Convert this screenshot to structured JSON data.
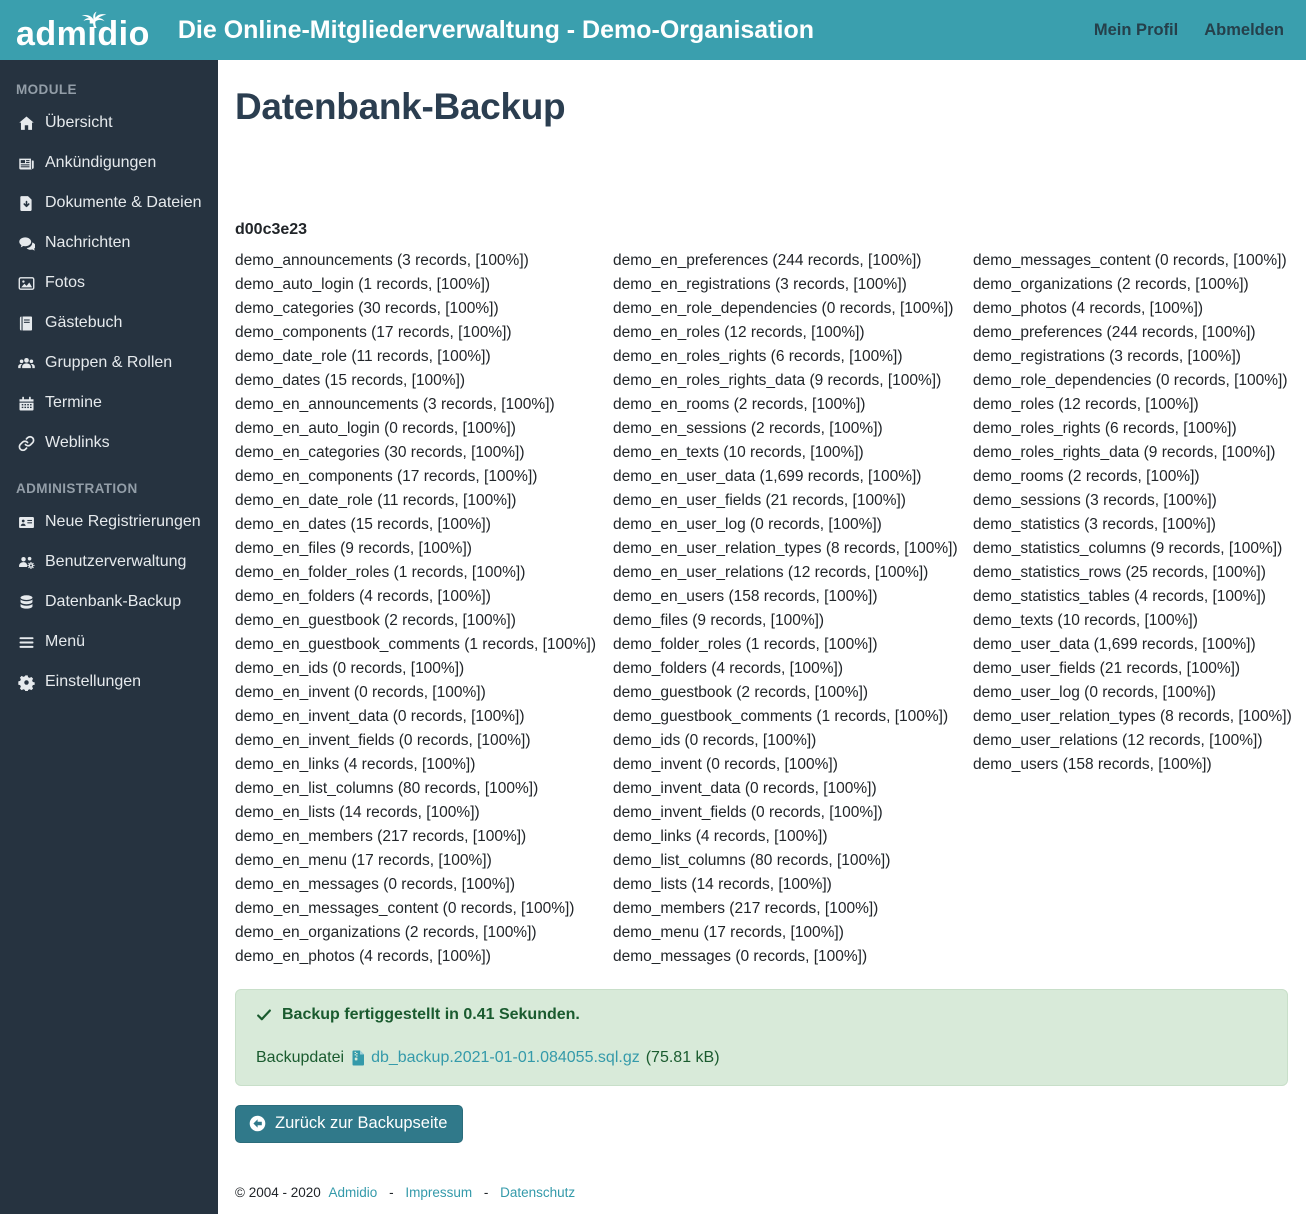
{
  "header": {
    "logo": "admidio",
    "title": "Die Online-Mitgliederverwaltung - Demo-Organisation",
    "nav": [
      {
        "label": "Mein Profil"
      },
      {
        "label": "Abmelden"
      }
    ]
  },
  "sidebar": {
    "sections": [
      {
        "label": "MODULE",
        "items": [
          {
            "icon": "home-icon",
            "label": "Übersicht"
          },
          {
            "icon": "newspaper-icon",
            "label": "Ankündigungen"
          },
          {
            "icon": "file-download-icon",
            "label": "Dokumente & Dateien"
          },
          {
            "icon": "comments-icon",
            "label": "Nachrichten"
          },
          {
            "icon": "image-icon",
            "label": "Fotos"
          },
          {
            "icon": "book-icon",
            "label": "Gästebuch"
          },
          {
            "icon": "users-icon",
            "label": "Gruppen & Rollen"
          },
          {
            "icon": "calendar-icon",
            "label": "Termine"
          },
          {
            "icon": "link-icon",
            "label": "Weblinks"
          }
        ]
      },
      {
        "label": "ADMINISTRATION",
        "items": [
          {
            "icon": "address-card-icon",
            "label": "Neue Registrierungen"
          },
          {
            "icon": "users-cog-icon",
            "label": "Benutzerverwaltung"
          },
          {
            "icon": "database-icon",
            "label": "Datenbank-Backup"
          },
          {
            "icon": "bars-icon",
            "label": "Menü"
          },
          {
            "icon": "gear-icon",
            "label": "Einstellungen"
          }
        ]
      }
    ]
  },
  "main": {
    "page_title": "Datenbank-Backup",
    "db_name": "d00c3e23",
    "tables": [
      "demo_announcements (3 records, [100%])",
      "demo_auto_login (1 records, [100%])",
      "demo_categories (30 records, [100%])",
      "demo_components (17 records, [100%])",
      "demo_date_role (11 records, [100%])",
      "demo_dates (15 records, [100%])",
      "demo_en_announcements (3 records, [100%])",
      "demo_en_auto_login (0 records, [100%])",
      "demo_en_categories (30 records, [100%])",
      "demo_en_components (17 records, [100%])",
      "demo_en_date_role (11 records, [100%])",
      "demo_en_dates (15 records, [100%])",
      "demo_en_files (9 records, [100%])",
      "demo_en_folder_roles (1 records, [100%])",
      "demo_en_folders (4 records, [100%])",
      "demo_en_guestbook (2 records, [100%])",
      "demo_en_guestbook_comments (1 records, [100%])",
      "demo_en_ids (0 records, [100%])",
      "demo_en_invent (0 records, [100%])",
      "demo_en_invent_data (0 records, [100%])",
      "demo_en_invent_fields (0 records, [100%])",
      "demo_en_links (4 records, [100%])",
      "demo_en_list_columns (80 records, [100%])",
      "demo_en_lists (14 records, [100%])",
      "demo_en_members (217 records, [100%])",
      "demo_en_menu (17 records, [100%])",
      "demo_en_messages (0 records, [100%])",
      "demo_en_messages_content (0 records, [100%])",
      "demo_en_organizations (2 records, [100%])",
      "demo_en_photos (4 records, [100%])",
      "demo_en_preferences (244 records, [100%])",
      "demo_en_registrations (3 records, [100%])",
      "demo_en_role_dependencies (0 records, [100%])",
      "demo_en_roles (12 records, [100%])",
      "demo_en_roles_rights (6 records, [100%])",
      "demo_en_roles_rights_data (9 records, [100%])",
      "demo_en_rooms (2 records, [100%])",
      "demo_en_sessions (2 records, [100%])",
      "demo_en_texts (10 records, [100%])",
      "demo_en_user_data (1,699 records, [100%])",
      "demo_en_user_fields (21 records, [100%])",
      "demo_en_user_log (0 records, [100%])",
      "demo_en_user_relation_types (8 records, [100%])",
      "demo_en_user_relations (12 records, [100%])",
      "demo_en_users (158 records, [100%])",
      "demo_files (9 records, [100%])",
      "demo_folder_roles (1 records, [100%])",
      "demo_folders (4 records, [100%])",
      "demo_guestbook (2 records, [100%])",
      "demo_guestbook_comments (1 records, [100%])",
      "demo_ids (0 records, [100%])",
      "demo_invent (0 records, [100%])",
      "demo_invent_data (0 records, [100%])",
      "demo_invent_fields (0 records, [100%])",
      "demo_links (4 records, [100%])",
      "demo_list_columns (80 records, [100%])",
      "demo_lists (14 records, [100%])",
      "demo_members (217 records, [100%])",
      "demo_menu (17 records, [100%])",
      "demo_messages (0 records, [100%])",
      "demo_messages_content (0 records, [100%])",
      "demo_organizations (2 records, [100%])",
      "demo_photos (4 records, [100%])",
      "demo_preferences (244 records, [100%])",
      "demo_registrations (3 records, [100%])",
      "demo_role_dependencies (0 records, [100%])",
      "demo_roles (12 records, [100%])",
      "demo_roles_rights (6 records, [100%])",
      "demo_roles_rights_data (9 records, [100%])",
      "demo_rooms (2 records, [100%])",
      "demo_sessions (3 records, [100%])",
      "demo_statistics (3 records, [100%])",
      "demo_statistics_columns (9 records, [100%])",
      "demo_statistics_rows (25 records, [100%])",
      "demo_statistics_tables (4 records, [100%])",
      "demo_texts (10 records, [100%])",
      "demo_user_data (1,699 records, [100%])",
      "demo_user_fields (21 records, [100%])",
      "demo_user_log (0 records, [100%])",
      "demo_user_relation_types (8 records, [100%])",
      "demo_user_relations (12 records, [100%])",
      "demo_users (158 records, [100%])"
    ],
    "alert": {
      "message": "Backup fertiggestellt in 0.41 Sekunden.",
      "file_label": "Backupdatei",
      "file_icon": "file-archive-icon",
      "file_name": "db_backup.2021-01-01.084055.sql.gz",
      "file_size": "(75.81 kB)"
    },
    "back_button_label": "Zurück zur Backupseite"
  },
  "footer": {
    "copyright": "© 2004 - 2020",
    "separator": "-",
    "links": [
      {
        "label": "Admidio"
      },
      {
        "label": "Impressum"
      },
      {
        "label": "Datenschutz"
      }
    ]
  },
  "colors": {
    "header_teal": "#3a9fae",
    "sidebar_dark": "#263340",
    "link_teal": "#349aaa",
    "button_teal": "#30798a",
    "alert_bg": "#d8ead9",
    "alert_text": "#1a5b2f",
    "title_dark": "#2b3e50"
  }
}
